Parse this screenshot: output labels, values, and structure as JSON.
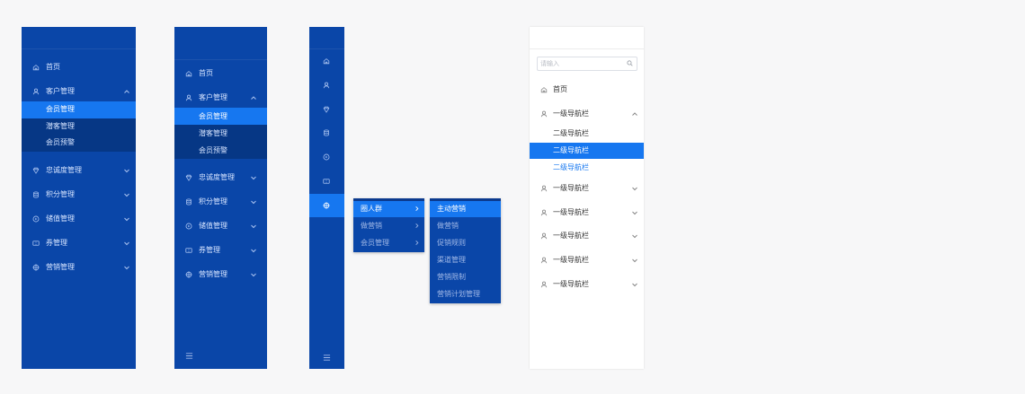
{
  "colors": {
    "sidebar_bg": "#0a46a8",
    "submenu_bg": "#063785",
    "active": "#1677f0",
    "canvas": "#f7f7f8"
  },
  "sidebar1": {
    "items": [
      {
        "label": "首页",
        "icon": "home-icon"
      },
      {
        "label": "客户管理",
        "icon": "user-icon",
        "expanded": true,
        "children": [
          "会员管理",
          "潜客管理",
          "会员预警"
        ],
        "active_child": 0
      },
      {
        "label": "忠诚度管理",
        "icon": "diamond-icon"
      },
      {
        "label": "积分管理",
        "icon": "database-icon"
      },
      {
        "label": "储值管理",
        "icon": "play-circle-icon"
      },
      {
        "label": "券管理",
        "icon": "ticket-icon"
      },
      {
        "label": "营销管理",
        "icon": "target-icon"
      }
    ]
  },
  "sidebar2": {
    "items": [
      {
        "label": "首页",
        "icon": "home-icon"
      },
      {
        "label": "客户管理",
        "icon": "user-icon",
        "expanded": true,
        "children": [
          "会员管理",
          "潜客管理",
          "会员预警"
        ],
        "active_child": 0
      },
      {
        "label": "忠诚度管理",
        "icon": "diamond-icon"
      },
      {
        "label": "积分管理",
        "icon": "database-icon"
      },
      {
        "label": "储值管理",
        "icon": "play-circle-icon"
      },
      {
        "label": "券管理",
        "icon": "ticket-icon"
      },
      {
        "label": "营销管理",
        "icon": "target-icon"
      }
    ],
    "collapse_icon": "menu-fold-icon"
  },
  "sidebar3": {
    "icons": [
      "home-icon",
      "user-icon",
      "diamond-icon",
      "database-icon",
      "play-circle-icon",
      "ticket-icon",
      "target-icon"
    ],
    "active_index": 6,
    "collapse_icon": "menu-fold-icon"
  },
  "flyout1": {
    "items": [
      "圈人群",
      "做营销",
      "会员管理"
    ],
    "active_index": 0
  },
  "flyout2": {
    "items": [
      "主动营销",
      "做营销",
      "促销规则",
      "渠道管理",
      "营销限制",
      "营销计划管理"
    ],
    "active_index": 0
  },
  "white_menu": {
    "search_placeholder": "请输入",
    "home_label": "首页",
    "level1_label": "一级导航栏",
    "children": [
      "二级导航栏",
      "二级导航栏",
      "二级导航栏"
    ],
    "active_child": 1,
    "hover_child": 2,
    "collapsed_count": 5
  }
}
